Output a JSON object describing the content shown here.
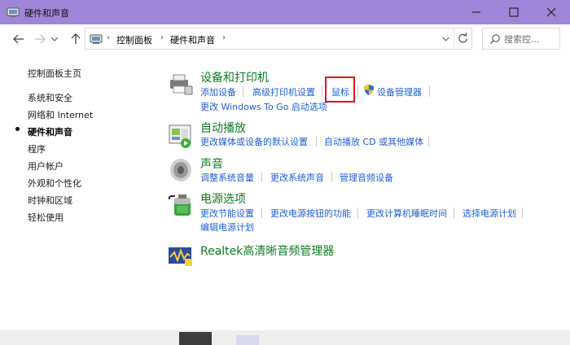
{
  "window": {
    "title": "硬件和声音",
    "title_bar_color": "#9f86d8"
  },
  "navigation": {
    "breadcrumbs": [
      "控制面板",
      "硬件和声音"
    ],
    "search_placeholder": "搜索控..."
  },
  "sidebar": {
    "items": [
      {
        "label": "控制面板主页",
        "current": false
      },
      {
        "label": "系统和安全",
        "current": false
      },
      {
        "label": "网络和 Internet",
        "current": false
      },
      {
        "label": "硬件和声音",
        "current": true
      },
      {
        "label": "程序",
        "current": false
      },
      {
        "label": "用户帐户",
        "current": false
      },
      {
        "label": "外观和个性化",
        "current": false
      },
      {
        "label": "时钟和区域",
        "current": false
      },
      {
        "label": "轻松使用",
        "current": false
      }
    ]
  },
  "categories": {
    "devices": {
      "title": "设备和打印机",
      "icon": "printer-icon",
      "links": [
        "添加设备",
        "高级打印机设置",
        "鼠标",
        "设备管理器",
        "更改 Windows To Go 启动选项"
      ]
    },
    "autoplay": {
      "title": "自动播放",
      "icon": "autoplay-icon",
      "links": [
        "更改媒体或设备的默认设置",
        "自动播放 CD 或其他媒体"
      ]
    },
    "sound": {
      "title": "声音",
      "icon": "speaker-icon",
      "links": [
        "调整系统音量",
        "更改系统声音",
        "管理音频设备"
      ]
    },
    "power": {
      "title": "电源选项",
      "icon": "battery-icon",
      "links": [
        "更改节能设置",
        "更改电源按钮的功能",
        "更改计算机睡眠时间",
        "选择电源计划",
        "编辑电源计划"
      ]
    },
    "realtek": {
      "title": "Realtek高清晰音频管理器",
      "icon": "realtek-icon"
    }
  },
  "colors": {
    "link": "#1f5fd6",
    "category_title": "#0d7a20",
    "highlight": "#e0141e"
  }
}
